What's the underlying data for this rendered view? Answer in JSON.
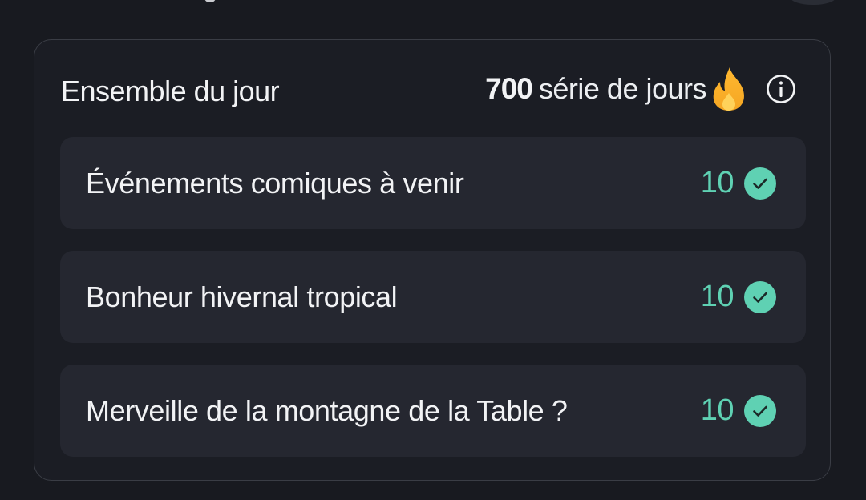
{
  "card": {
    "title": "Ensemble du jour",
    "streak": {
      "count": "700",
      "label": "série de jours",
      "icon": "fire-icon"
    },
    "info_icon": "info-icon"
  },
  "rows": [
    {
      "label": "Événements comiques à venir",
      "score": "10",
      "status_icon": "check-circle-icon"
    },
    {
      "label": "Bonheur hivernal tropical",
      "score": "10",
      "status_icon": "check-circle-icon"
    },
    {
      "label": "Merveille de la montagne de la Table ?",
      "score": "10",
      "status_icon": "check-circle-icon"
    }
  ],
  "colors": {
    "background": "#181a20",
    "card": "#1b1d24",
    "row": "#252730",
    "accent": "#5fd1b3",
    "fire": "#f7b731"
  }
}
